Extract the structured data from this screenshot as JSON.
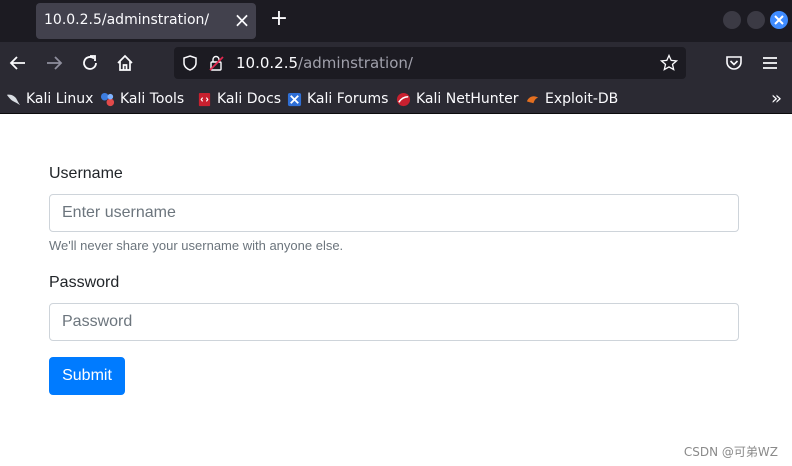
{
  "browser": {
    "tab_title": "10.0.2.5/adminstration/",
    "url_host": "10.0.2.5",
    "url_path": "/adminstration/",
    "bookmarks": [
      {
        "label": "Kali Linux",
        "icon": "kali-dragon-icon"
      },
      {
        "label": "Kali Tools",
        "icon": "kali-tools-icon"
      },
      {
        "label": "Kali Docs",
        "icon": "kali-docs-icon"
      },
      {
        "label": "Kali Forums",
        "icon": "kali-forums-icon"
      },
      {
        "label": "Kali NetHunter",
        "icon": "kali-nethunter-icon"
      },
      {
        "label": "Exploit-DB",
        "icon": "exploit-db-icon"
      }
    ],
    "accent_color": "#3f8cff"
  },
  "form": {
    "username_label": "Username",
    "username_placeholder": "Enter username",
    "username_help": "We'll never share your username with anyone else.",
    "password_label": "Password",
    "password_placeholder": "Password",
    "submit_label": "Submit",
    "primary_color": "#007bff"
  },
  "watermark": "CSDN @可弟WZ"
}
